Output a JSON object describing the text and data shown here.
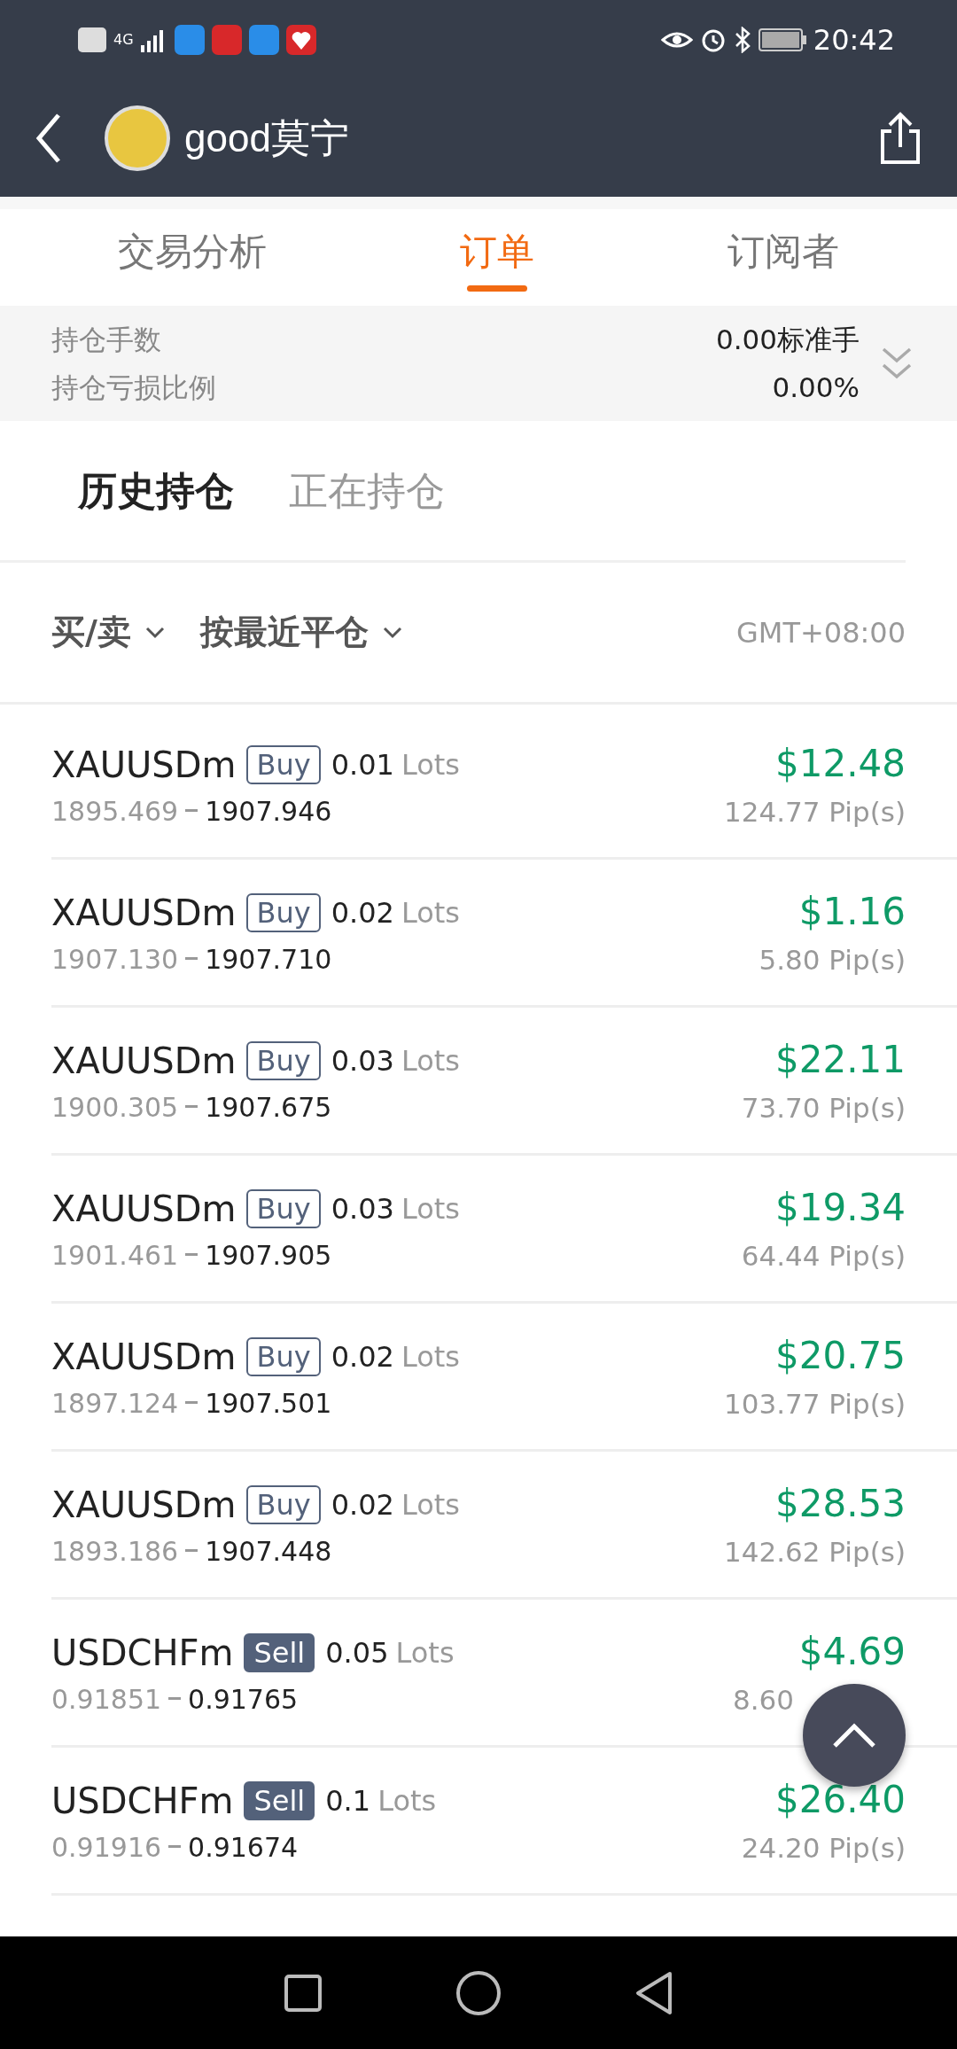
{
  "status_bar": {
    "time": "20:42",
    "network": "4G"
  },
  "header": {
    "title": "good莫宁"
  },
  "tabs": [
    {
      "label": "交易分析",
      "selected": false
    },
    {
      "label": "订单",
      "selected": true
    },
    {
      "label": "订阅者",
      "selected": false
    }
  ],
  "summary": [
    {
      "label": "持仓手数",
      "value": "0.00标准手"
    },
    {
      "label": "持仓亏损比例",
      "value": "0.00%"
    }
  ],
  "sub_tabs": [
    {
      "label": "历史持仓",
      "selected": true
    },
    {
      "label": "正在持仓",
      "selected": false
    }
  ],
  "filters": [
    {
      "label": "买/卖"
    },
    {
      "label": "按最近平仓"
    }
  ],
  "timezone": "GMT+08:00",
  "orders": [
    {
      "symbol": "XAUUSDm",
      "side": {
        "kind": "buy",
        "label": "Buy"
      },
      "lots": "0.01",
      "lots_unit": "Lots",
      "open": "1895.469",
      "close": "1907.946",
      "profit": "$12.48",
      "pips": "124.77 Pip(s)"
    },
    {
      "symbol": "XAUUSDm",
      "side": {
        "kind": "buy",
        "label": "Buy"
      },
      "lots": "0.02",
      "lots_unit": "Lots",
      "open": "1907.130",
      "close": "1907.710",
      "profit": "$1.16",
      "pips": "5.80 Pip(s)"
    },
    {
      "symbol": "XAUUSDm",
      "side": {
        "kind": "buy",
        "label": "Buy"
      },
      "lots": "0.03",
      "lots_unit": "Lots",
      "open": "1900.305",
      "close": "1907.675",
      "profit": "$22.11",
      "pips": "73.70 Pip(s)"
    },
    {
      "symbol": "XAUUSDm",
      "side": {
        "kind": "buy",
        "label": "Buy"
      },
      "lots": "0.03",
      "lots_unit": "Lots",
      "open": "1901.461",
      "close": "1907.905",
      "profit": "$19.34",
      "pips": "64.44 Pip(s)"
    },
    {
      "symbol": "XAUUSDm",
      "side": {
        "kind": "buy",
        "label": "Buy"
      },
      "lots": "0.02",
      "lots_unit": "Lots",
      "open": "1897.124",
      "close": "1907.501",
      "profit": "$20.75",
      "pips": "103.77 Pip(s)"
    },
    {
      "symbol": "XAUUSDm",
      "side": {
        "kind": "buy",
        "label": "Buy"
      },
      "lots": "0.02",
      "lots_unit": "Lots",
      "open": "1893.186",
      "close": "1907.448",
      "profit": "$28.53",
      "pips": "142.62 Pip(s)"
    },
    {
      "symbol": "USDCHFm",
      "side": {
        "kind": "sell",
        "label": "Sell"
      },
      "lots": "0.05",
      "lots_unit": "Lots",
      "open": "0.91851",
      "close": "0.91765",
      "profit": "$4.69",
      "pips": "8.60"
    },
    {
      "symbol": "USDCHFm",
      "side": {
        "kind": "sell",
        "label": "Sell"
      },
      "lots": "0.1",
      "lots_unit": "Lots",
      "open": "0.91916",
      "close": "0.91674",
      "profit": "$26.40",
      "pips": "24.20 Pip(s)"
    }
  ]
}
